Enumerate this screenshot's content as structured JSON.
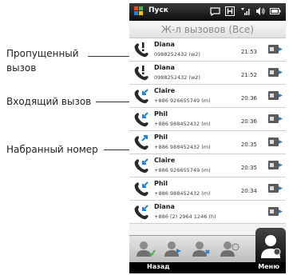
{
  "annotations": {
    "missed_line1": "Пропущенный",
    "missed_line2": "вызов",
    "incoming": "Входящий вызов",
    "dialed": "Набранный номер"
  },
  "statusbar": {
    "title": "Пуск",
    "icons": [
      "windows-icon",
      "message-icon",
      "h-network-icon",
      "signal-icon",
      "speaker-icon",
      "battery-icon"
    ]
  },
  "header": {
    "title": "Ж-л вызовов (Все)"
  },
  "calls": [
    {
      "type": "missed",
      "name": "Diana",
      "number": "0988252432 (w2)",
      "time": "21:53"
    },
    {
      "type": "missed",
      "name": "Diana",
      "number": "0988252432 (w2)",
      "time": "21:52"
    },
    {
      "type": "incoming",
      "name": "Claire",
      "number": "+886 926655749 (m)",
      "time": "20:36"
    },
    {
      "type": "incoming",
      "name": "Phil",
      "number": "+886 988452432 (m)",
      "time": "20:36"
    },
    {
      "type": "dialed",
      "name": "Phil",
      "number": "+886 988452432 (m)",
      "time": "20:35"
    },
    {
      "type": "incoming",
      "name": "Claire",
      "number": "+886 926655749 (m)",
      "time": "20:35"
    },
    {
      "type": "incoming",
      "name": "Phil",
      "number": "+886 988452432 (m)",
      "time": "20:34"
    },
    {
      "type": "incoming",
      "name": "Diana",
      "number": "+886 (2) 2964 1246 (h)",
      "time": ""
    }
  ],
  "tabs": [
    "contacts-tab",
    "call-history-tab",
    "favorites-tab",
    "groups-tab",
    "active-contacts-tab"
  ],
  "softkeys": {
    "left": "Назад",
    "right": "Меню"
  },
  "colors": {
    "missed_icon": "#222222",
    "incoming_arrow": "#2a7fd4",
    "statusbar": "#1a1a1a"
  }
}
